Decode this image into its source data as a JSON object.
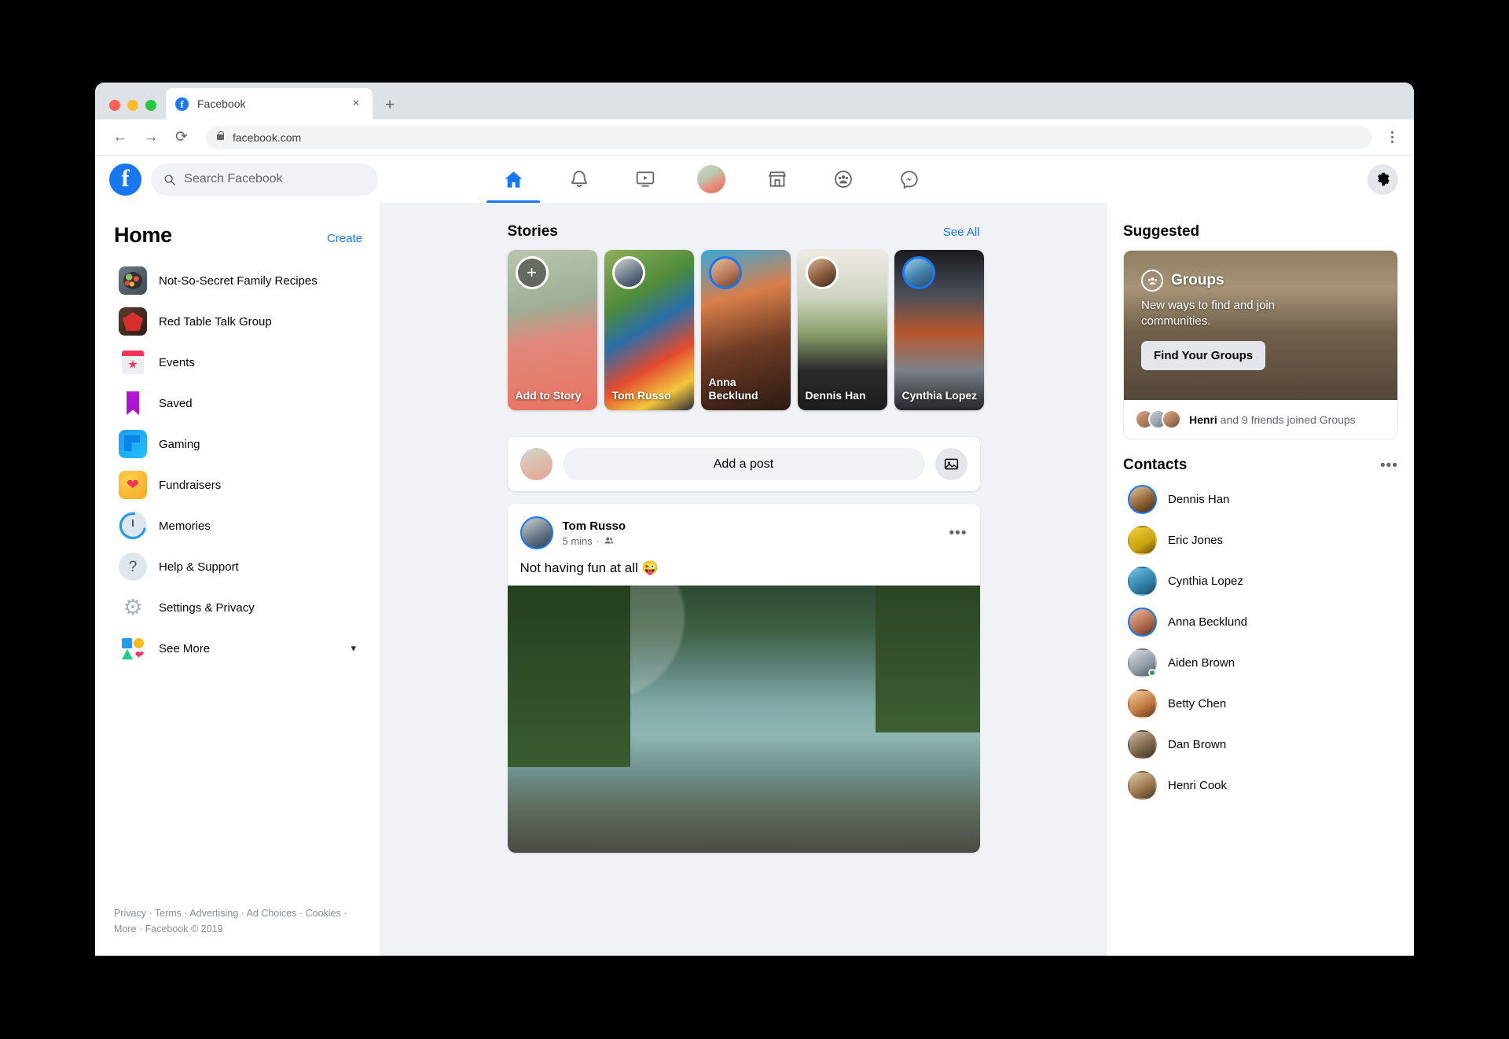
{
  "browser": {
    "tab_title": "Facebook",
    "tab_favicon": "f",
    "close_label": "×",
    "newtab_label": "+",
    "back_icon": "←",
    "forward_icon": "→",
    "reload_icon": "⟳",
    "url": "facebook.com"
  },
  "topnav": {
    "logo_letter": "f",
    "search_placeholder": "Search Facebook",
    "items": [
      {
        "name": "home",
        "label": "Home",
        "active": true
      },
      {
        "name": "notifications",
        "label": "Notifications",
        "active": false
      },
      {
        "name": "watch",
        "label": "Watch",
        "active": false
      },
      {
        "name": "profile",
        "label": "Profile",
        "active": false
      },
      {
        "name": "marketplace",
        "label": "Marketplace",
        "active": false
      },
      {
        "name": "groups",
        "label": "Groups",
        "active": false
      },
      {
        "name": "messenger",
        "label": "Messenger",
        "active": false
      }
    ],
    "settings_label": "Settings"
  },
  "sidebar": {
    "title": "Home",
    "create_label": "Create",
    "items": [
      {
        "label": "Not-So-Secret Family Recipes",
        "icon": "recipes-thumbnail-icon"
      },
      {
        "label": "Red Table Talk Group",
        "icon": "red-table-thumbnail-icon"
      },
      {
        "label": "Events",
        "icon": "events-calendar-icon"
      },
      {
        "label": "Saved",
        "icon": "saved-bookmark-icon"
      },
      {
        "label": "Gaming",
        "icon": "gaming-icon"
      },
      {
        "label": "Fundraisers",
        "icon": "fundraisers-heart-icon"
      },
      {
        "label": "Memories",
        "icon": "memories-clock-icon"
      },
      {
        "label": "Help & Support",
        "icon": "help-question-icon"
      },
      {
        "label": "Settings & Privacy",
        "icon": "settings-gear-icon"
      },
      {
        "label": "See More",
        "icon": "see-more-shapes-icon"
      }
    ],
    "footer": "Privacy · Terms · Advertising · Ad Choices · Cookies · More · Facebook © 2019"
  },
  "stories": {
    "title": "Stories",
    "see_all": "See All",
    "add_icon": "+",
    "items": [
      {
        "name": "Add to Story",
        "type": "add"
      },
      {
        "name": "Tom Russo",
        "type": "story"
      },
      {
        "name": "Anna Becklund",
        "type": "story"
      },
      {
        "name": "Dennis Han",
        "type": "story"
      },
      {
        "name": "Cynthia Lopez",
        "type": "story"
      }
    ]
  },
  "composer": {
    "placeholder": "Add a post",
    "photo_icon": "photo-icon"
  },
  "post": {
    "author": "Tom Russo",
    "time": "5 mins",
    "audience_icon": "friends-icon",
    "more_icon": "•••",
    "text": "Not having fun at all 😜"
  },
  "rightbar": {
    "suggested_title": "Suggested",
    "groups_card": {
      "badge": "Groups",
      "description": "New ways to find and join communities.",
      "button": "Find Your Groups",
      "footer_highlight": "Henri",
      "footer_rest": " and 9 friends joined Groups"
    },
    "contacts_title": "Contacts",
    "contacts_more_icon": "•••",
    "contacts": [
      {
        "name": "Dennis Han",
        "ring": true,
        "online": false
      },
      {
        "name": "Eric Jones",
        "ring": false,
        "online": false
      },
      {
        "name": "Cynthia Lopez",
        "ring": false,
        "online": false
      },
      {
        "name": "Anna Becklund",
        "ring": true,
        "online": false
      },
      {
        "name": "Aiden Brown",
        "ring": false,
        "online": true
      },
      {
        "name": "Betty Chen",
        "ring": false,
        "online": false
      },
      {
        "name": "Dan Brown",
        "ring": false,
        "online": false
      },
      {
        "name": "Henri Cook",
        "ring": false,
        "online": false
      }
    ]
  }
}
